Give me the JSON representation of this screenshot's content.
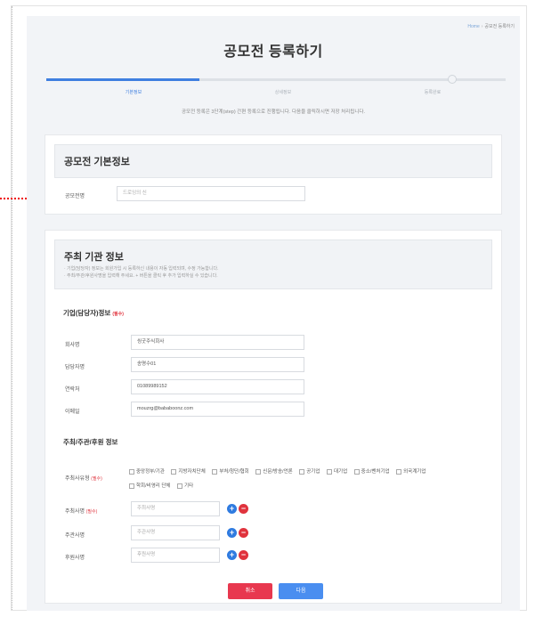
{
  "breadcrumb": {
    "home": "Home",
    "current": "공모전 등록하기"
  },
  "page_title": "공모전 등록하기",
  "steps": [
    {
      "label": "기본정보",
      "active": true
    },
    {
      "label": "상세정보",
      "active": false
    },
    {
      "label": "등록완료",
      "active": false
    }
  ],
  "step_note": "공모전 등록은 3단계(step) 간편 등록으로 진행됩니다. 다음을 클릭하시면 저장 처리됩니다.",
  "basic_card": {
    "title": "공모전 기본정보",
    "contest_name_label": "공모전명",
    "contest_name_placeholder": "드로잉의 신"
  },
  "host_card": {
    "title": "주최 기관 정보",
    "desc_1": "· 기업(담당자) 정보는 회원가입 시 등록하신 내용이 자동 입력되며, 수정 가능합니다.",
    "desc_2": "· 주최/주관/후원사명을 입력해 주세요. + 버튼을 클릭 후 추가 입력하실 수 있습니다.",
    "company_section": "기업(담당자)정보",
    "required": "(필수)",
    "fields": [
      {
        "label": "회사명",
        "value": "씽굿주식회사"
      },
      {
        "label": "담당자명",
        "value": "송명수01"
      },
      {
        "label": "연락처",
        "value": "01089989152"
      },
      {
        "label": "이메일",
        "value": "mouzrg@bababoonz.com"
      }
    ],
    "org_section": "주최/주관/후원 정보",
    "host_type_label": "주최사유형",
    "host_types_row1": [
      "중앙정부/기관",
      "지방자치단체",
      "부처/청단/협회",
      "신문/방송/언론",
      "공기업",
      "대기업",
      "중소/벤처기업",
      "외국계기업"
    ],
    "host_types_row2": [
      "학회/비영리 단체",
      "기타"
    ],
    "host_label": "주최사명",
    "host_placeholder": "주최사명",
    "organizer_label": "주관사명",
    "organizer_placeholder": "주관사명",
    "sponsor_label": "후원사명",
    "sponsor_placeholder": "후원사명",
    "plus_glyph": "+",
    "minus_glyph": "−"
  },
  "buttons": {
    "cancel": "취소",
    "next": "다음"
  },
  "colors": {
    "accent": "#3f7fe0",
    "danger": "#e8384f",
    "annotation_arrow": "#e00000"
  }
}
